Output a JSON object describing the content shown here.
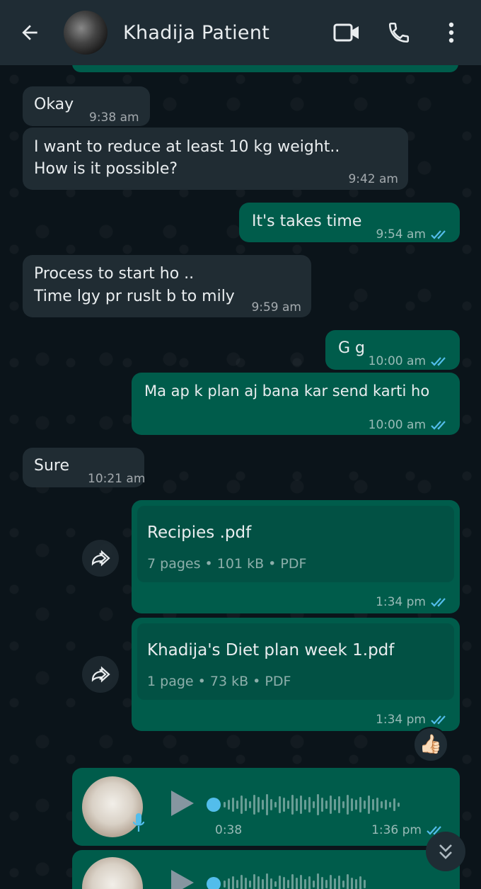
{
  "header": {
    "contact_name": "Khadija Patient",
    "icons": [
      "back-arrow-icon",
      "video-call-icon",
      "phone-call-icon",
      "more-options-icon"
    ]
  },
  "messages": [
    {
      "dir": "in",
      "text": "Okay",
      "time": "9:38 am"
    },
    {
      "dir": "in",
      "line1": "I want to reduce at least 10 kg weight..",
      "line2": "How is it possible?",
      "time": "9:42 am"
    },
    {
      "dir": "out",
      "text": "It's takes time",
      "time": "9:54 am",
      "status": "read"
    },
    {
      "dir": "in",
      "line1": "Process to start ho ..",
      "line2": "Time lgy pr ruslt b to mily",
      "time": "9:59 am"
    },
    {
      "dir": "out",
      "text": "G g",
      "time": "10:00 am",
      "status": "read"
    },
    {
      "dir": "out",
      "text": "Ma ap k plan aj bana kar send karti ho",
      "time": "10:00 am",
      "status": "read"
    },
    {
      "dir": "in",
      "text": "Sure",
      "time": "10:21 am"
    }
  ],
  "documents": [
    {
      "name": "Recipies .pdf",
      "meta": "7 pages • 101 kB • PDF",
      "time": "1:34 pm",
      "status": "read"
    },
    {
      "name": "Khadija's Diet plan week 1.pdf",
      "meta": "1 page • 73 kB • PDF",
      "time": "1:34 pm",
      "status": "read",
      "reaction": "👍🏻"
    }
  ],
  "voice_notes": [
    {
      "duration": "0:38",
      "time": "1:36 pm",
      "status": "read"
    }
  ],
  "colors": {
    "header_bg": "#1f2c34",
    "chat_bg": "#0b141a",
    "incoming_bubble": "#202c33",
    "outgoing_bubble": "#005c4b",
    "read_tick": "#53bdeb",
    "play_accent": "#53bdeb"
  }
}
